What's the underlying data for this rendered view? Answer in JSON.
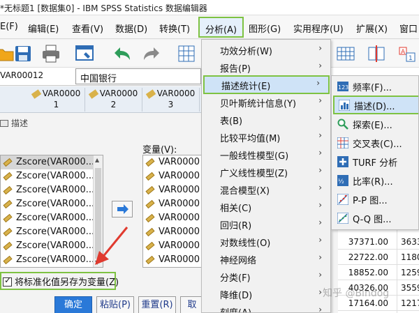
{
  "window": {
    "title": "*无标题1 [数据集0] - IBM SPSS Statistics 数据编辑器"
  },
  "menubar": [
    {
      "label": "E(F)"
    },
    {
      "label": "编辑(E)"
    },
    {
      "label": "查看(V)"
    },
    {
      "label": "数据(D)"
    },
    {
      "label": "转换(T)"
    },
    {
      "label": "分析(A)"
    },
    {
      "label": "图形(G)"
    },
    {
      "label": "实用程序(U)"
    },
    {
      "label": "扩展(X)"
    },
    {
      "label": "窗口"
    }
  ],
  "cell": {
    "ref": "VAR00012",
    "value": "中国银行"
  },
  "columns": [
    {
      "name": "VAR0000",
      "num": "1"
    },
    {
      "name": "VAR0000",
      "num": "2"
    },
    {
      "name": "VAR0000",
      "num": "3"
    }
  ],
  "dialog": {
    "title": "描述",
    "source_items": [
      "Zscore(VAR000...",
      "Zscore(VAR000...",
      "Zscore(VAR000...",
      "Zscore(VAR000...",
      "Zscore(VAR000...",
      "Zscore(VAR000...",
      "Zscore(VAR000...",
      "Zscore(VAR000..."
    ],
    "variables_label": "变量(V):",
    "variables": [
      "VAR0000",
      "VAR0000",
      "VAR0000",
      "VAR0000",
      "VAR0000",
      "VAR0000",
      "VAR0000",
      "VAR0000"
    ],
    "save_checkbox_label": "将标准化值另存为变量(Z)",
    "save_checked": true,
    "buttons": {
      "ok": "确定",
      "paste": "粘贴(P)",
      "reset": "重置(R)",
      "cancel": "取"
    }
  },
  "analyze_menu": [
    {
      "label": "功效分析(W)"
    },
    {
      "label": "报告(P)"
    },
    {
      "label": "描述统计(E)"
    },
    {
      "label": "贝叶斯统计信息(Y)"
    },
    {
      "label": "表(B)"
    },
    {
      "label": "比较平均值(M)"
    },
    {
      "label": "一般线性模型(G)"
    },
    {
      "label": "广义线性模型(Z)"
    },
    {
      "label": "混合模型(X)"
    },
    {
      "label": "相关(C)"
    },
    {
      "label": "回归(R)"
    },
    {
      "label": "对数线性(O)"
    },
    {
      "label": "神经网络"
    },
    {
      "label": "分类(F)"
    },
    {
      "label": "降维(D)"
    },
    {
      "label": "刻度(A)"
    }
  ],
  "analyze_arrow": "›",
  "descriptive_submenu": [
    {
      "label": "频率(F)...",
      "icon": "frequencies-icon"
    },
    {
      "label": "描述(D)...",
      "icon": "descriptives-icon"
    },
    {
      "label": "探索(E)...",
      "icon": "explore-icon"
    },
    {
      "label": "交叉表(C)...",
      "icon": "crosstabs-icon"
    },
    {
      "label": "TURF 分析",
      "icon": "turf-icon"
    },
    {
      "label": "比率(R)...",
      "icon": "ratio-icon"
    },
    {
      "label": "P-P 图...",
      "icon": "pp-plot-icon"
    },
    {
      "label": "Q-Q 图...",
      "icon": "qq-plot-icon"
    }
  ],
  "data_rows": [
    [
      "37371.00",
      "3633"
    ],
    [
      "22722.00",
      "1180"
    ],
    [
      "18852.00",
      "1259"
    ],
    [
      "40326.00",
      "3559"
    ],
    [
      "17164.00",
      "1217"
    ]
  ],
  "watermark": "知乎 @Bindog",
  "colors": {
    "highlight_border": "#7ec242",
    "highlight_fill": "#cfe3f7",
    "primary_button": "#2a79d8",
    "annotation_arrow": "#e03a2f"
  }
}
